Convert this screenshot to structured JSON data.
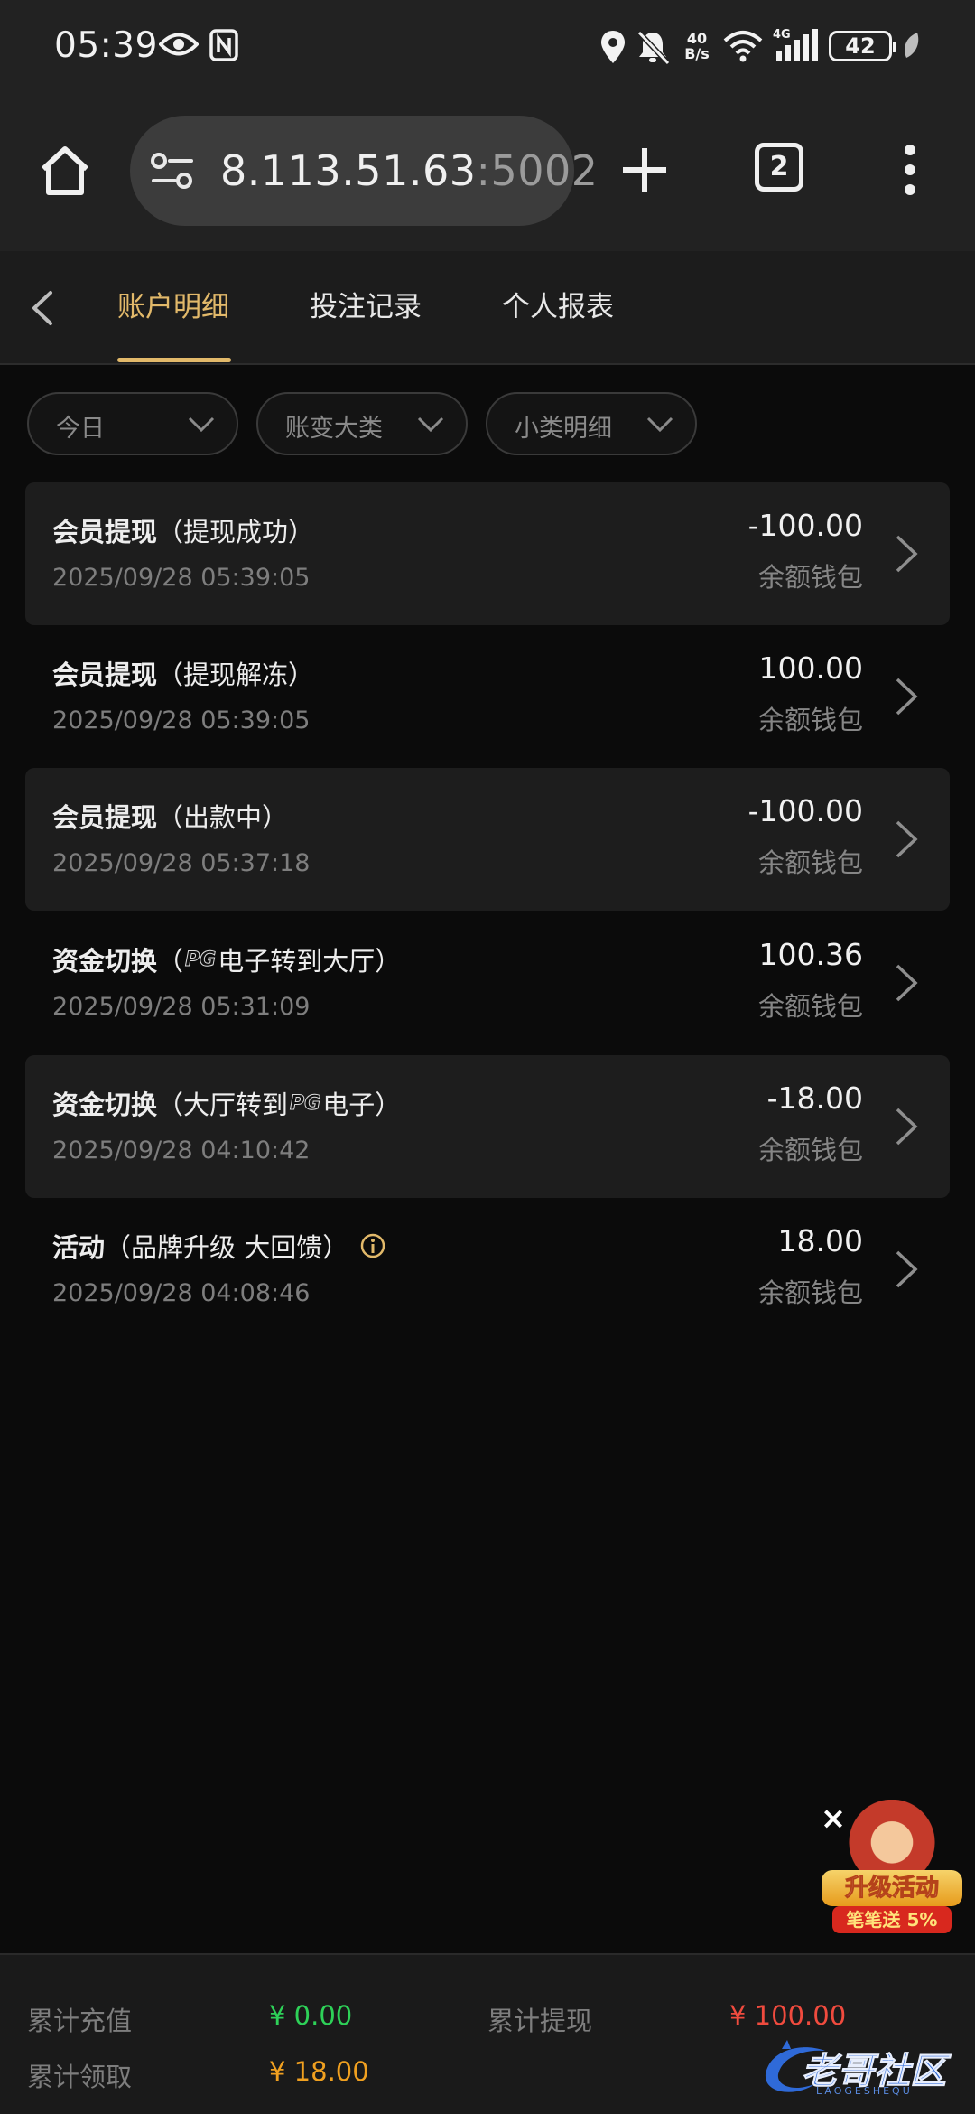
{
  "status_bar": {
    "time": "05:39",
    "net_speed_top": "40",
    "net_speed_bottom": "B/s",
    "battery": "42",
    "icons": [
      "eye-icon",
      "nfc-icon",
      "location-icon",
      "bell-off-icon",
      "wifi-icon",
      "signal-4g-icon",
      "leaf-icon"
    ]
  },
  "browser": {
    "url_host": "8.113.51.63",
    "url_port": ":5002",
    "tab_count": "2"
  },
  "nav": {
    "tabs": [
      {
        "label": "账户明细",
        "active": true
      },
      {
        "label": "投注记录",
        "active": false
      },
      {
        "label": "个人报表",
        "active": false
      }
    ]
  },
  "filters": [
    {
      "label": "今日"
    },
    {
      "label": "账变大类"
    },
    {
      "label": "小类明细"
    }
  ],
  "records": [
    {
      "title": "会员提现",
      "detail_before": "（提现成功）",
      "pg": "",
      "detail_after": "",
      "info": false,
      "time": "2025/09/28 05:39:05",
      "amount": "-100.00",
      "wallet": "余额钱包"
    },
    {
      "title": "会员提现",
      "detail_before": "（提现解冻）",
      "pg": "",
      "detail_after": "",
      "info": false,
      "time": "2025/09/28 05:39:05",
      "amount": "100.00",
      "wallet": "余额钱包"
    },
    {
      "title": "会员提现",
      "detail_before": "（出款中）",
      "pg": "",
      "detail_after": "",
      "info": false,
      "time": "2025/09/28 05:37:18",
      "amount": "-100.00",
      "wallet": "余额钱包"
    },
    {
      "title": "资金切换",
      "detail_before": "（",
      "pg": "PG",
      "detail_after": "电子转到大厅）",
      "info": false,
      "time": "2025/09/28 05:31:09",
      "amount": "100.36",
      "wallet": "余额钱包"
    },
    {
      "title": "资金切换",
      "detail_before": "（大厅转到",
      "pg": "PG",
      "detail_after": "电子）",
      "info": false,
      "time": "2025/09/28 04:10:42",
      "amount": "-18.00",
      "wallet": "余额钱包"
    },
    {
      "title": "活动",
      "detail_before": "（品牌升级 大回馈）",
      "pg": "",
      "detail_after": "",
      "info": true,
      "time": "2025/09/28 04:08:46",
      "amount": "18.00",
      "wallet": "余额钱包"
    }
  ],
  "promo": {
    "close": "×",
    "title": "升级活动",
    "subtitle": "笔笔送 5%"
  },
  "summary": {
    "recharge_label": "累计充值",
    "recharge_value": "¥ 0.00",
    "withdraw_label": "累计提现",
    "withdraw_value": "¥ 100.00",
    "claim_label": "累计领取",
    "claim_value": "¥ 18.00",
    "colors": {
      "recharge": "#2ed158",
      "withdraw": "#f04b3e",
      "claim": "#f0a020"
    }
  },
  "watermark": {
    "text": "老哥社区",
    "sub": "LAOGESHEQU"
  },
  "colors": {
    "accent": "#e2b96a",
    "background": "#0b0b0b"
  }
}
